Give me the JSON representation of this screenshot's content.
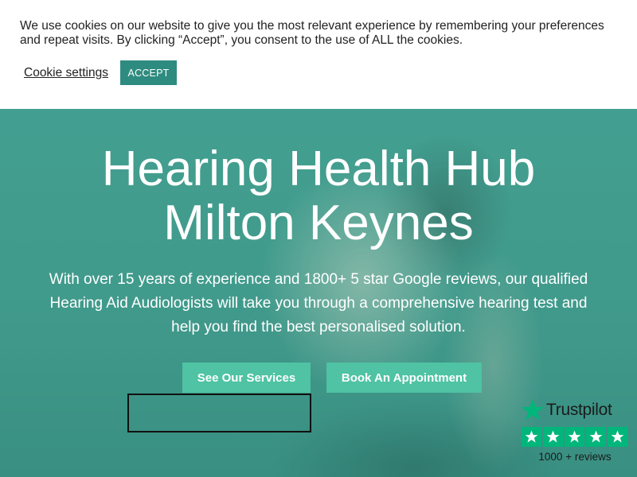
{
  "cookie": {
    "message": "We use cookies on our website to give you the most relevant experience by remembering your preferences and repeat visits. By clicking “Accept”, you consent to the use of ALL the cookies.",
    "settings_label": "Cookie settings",
    "accept_label": "ACCEPT",
    "accent_color": "#2e8b7f"
  },
  "hero": {
    "title_line1": "Hearing Health Hub",
    "title_line2": "Milton Keynes",
    "description": "With over 15 years of experience and 1800+ 5 star Google reviews, our qualified Hearing Aid Audiologists will take you through a comprehensive hearing test and help you find the best personalised solution.",
    "buttons": [
      {
        "label": "See Our Services"
      },
      {
        "label": "Book An Appointment"
      }
    ],
    "button_color": "#4fc3a3",
    "background_color": "#4aa092"
  },
  "trustpilot": {
    "brand": "Trustpilot",
    "rating_stars": 5,
    "reviews_text": "1000 + reviews",
    "icon": "trustpilot-star-icon",
    "star_color": "#00b67a"
  }
}
